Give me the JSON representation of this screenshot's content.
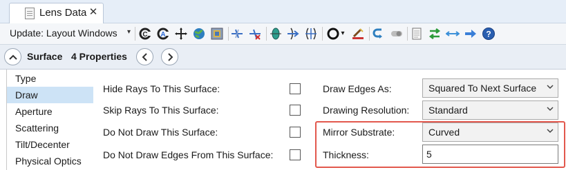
{
  "tab": {
    "title": "Lens Data",
    "close_glyph": "✕",
    "icon": "document-icon"
  },
  "toolbar": {
    "update_label": "Update: Layout Windows",
    "caret": "▾",
    "icons": [
      "refresh-c-icon",
      "refresh-a-icon",
      "crosshair-icon",
      "globe-icon",
      "pattern-icon",
      "ray-split-icon",
      "ray-split-red-icon",
      "lens-green-icon",
      "lens-arrow-icon",
      "lens-cross-icon",
      "circle-dropdown-icon",
      "wizard-icon",
      "undo-arrow-icon",
      "toggle-icon",
      "document-icon",
      "transfer-arrows-icon",
      "double-arrow-icon",
      "right-arrow-icon",
      "help-icon"
    ]
  },
  "surface_bar": {
    "title": "Surface",
    "count": "4 Properties",
    "collapse_glyph": "^",
    "prev_glyph": "‹",
    "next_glyph": "›"
  },
  "categories": [
    "Type",
    "Draw",
    "Aperture",
    "Scattering",
    "Tilt/Decenter",
    "Physical Optics"
  ],
  "selected_category": "Draw",
  "draw": {
    "hide_rays_label": "Hide Rays To This Surface:",
    "skip_rays_label": "Skip Rays To This Surface:",
    "do_not_draw_label": "Do Not Draw This Surface:",
    "do_not_draw_edges_label": "Do Not Draw Edges From This Surface:",
    "draw_edges_as_label": "Draw Edges As:",
    "draw_edges_as_value": "Squared To Next Surface",
    "drawing_resolution_label": "Drawing Resolution:",
    "drawing_resolution_value": "Standard",
    "mirror_substrate_label": "Mirror Substrate:",
    "mirror_substrate_value": "Curved",
    "thickness_label": "Thickness:",
    "thickness_value": "5"
  },
  "colors": {
    "highlight": "#e2574c",
    "selection": "#cde3f6",
    "tab_strip": "#e6eef8"
  }
}
